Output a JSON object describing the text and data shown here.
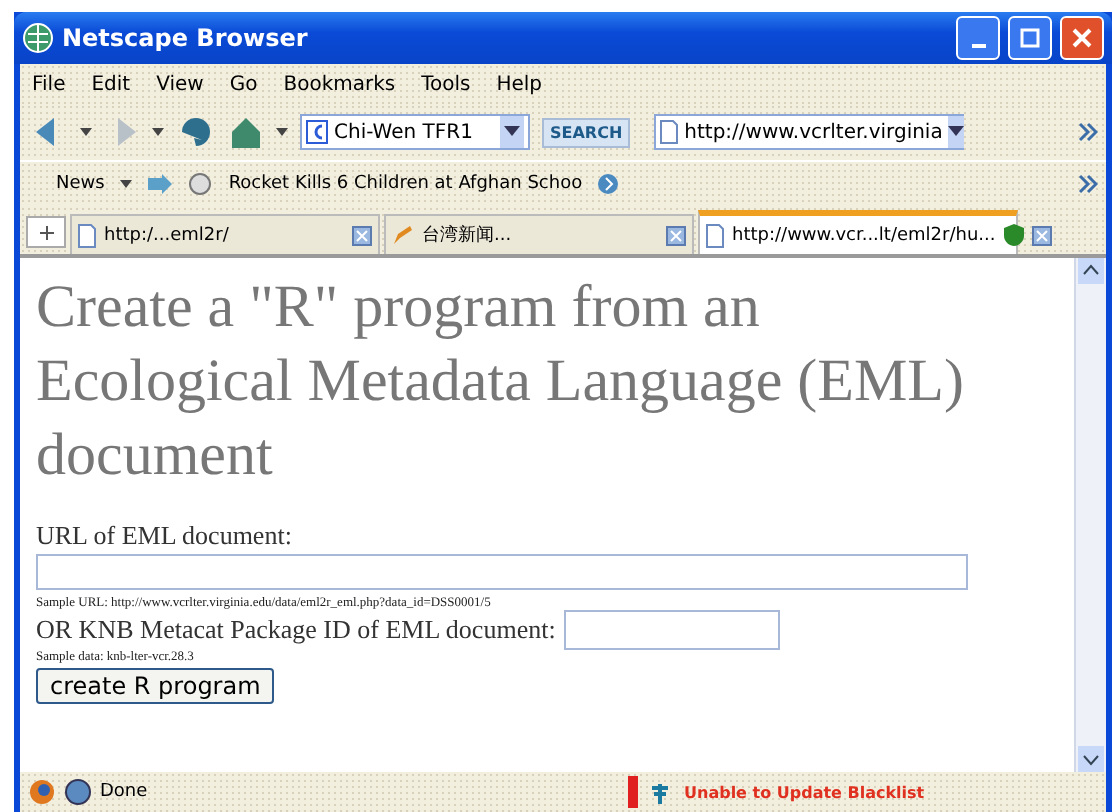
{
  "window": {
    "title": "Netscape Browser"
  },
  "menu": [
    "File",
    "Edit",
    "View",
    "Go",
    "Bookmarks",
    "Tools",
    "Help"
  ],
  "nav_toolbar": {
    "search_field": "Chi-Wen TFR1",
    "search_button": "SEARCH",
    "address": "http://www.vcrlter.virginia"
  },
  "news_toolbar": {
    "feed": "News",
    "headline": "Rocket Kills 6 Children at Afghan Schoo"
  },
  "tabs": [
    {
      "label": "http:/...eml2r/",
      "selected": false
    },
    {
      "label": "台湾新闻...",
      "selected": false
    },
    {
      "label": "http://www.vcr...lt/eml2r/hu...",
      "selected": true
    }
  ],
  "page": {
    "heading": "Create a \"R\" program from an Ecological Metadata Language (EML) document",
    "url_label": "URL of EML document:",
    "url_sample": "Sample URL: http://www.vcrlter.virginia.edu/data/eml2r_eml.php?data_id=DSS0001/5",
    "id_label": "OR KNB Metacat Package ID of EML document:",
    "id_sample": "Sample data: knb-lter-vcr.28.3",
    "button": "create R program"
  },
  "status": {
    "text": "Done",
    "blacklist": "Unable to Update Blacklist"
  }
}
